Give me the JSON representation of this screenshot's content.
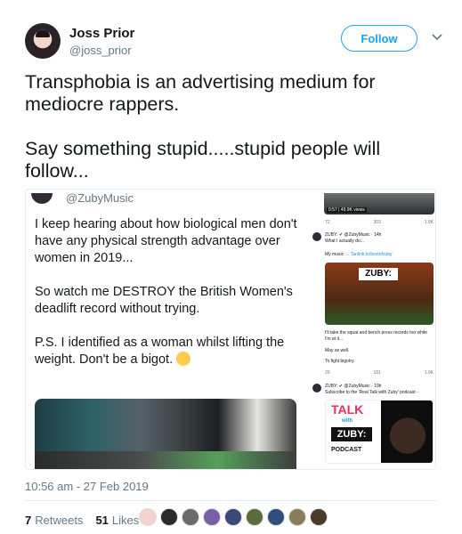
{
  "author": {
    "name": "Joss Prior",
    "handle": "@joss_prior",
    "follow_label": "Follow"
  },
  "tweet": {
    "paragraphs": [
      "Transphobia is an advertising medium for mediocre rappers.",
      "Say something stupid.....stupid people will follow..."
    ],
    "timestamp": "10:56 am - 27 Feb 2019"
  },
  "quoted": {
    "handle": "@ZubyMusic",
    "paragraphs": [
      "I keep hearing about how biological men don't have any physical strength advantage over women in 2019...",
      "So watch me DESTROY the British Women's deadlift record without trying.",
      "P.S. I identified as a woman whilst lifting the weight. Don't be a bigot."
    ]
  },
  "right_column": {
    "video_label": "0:57 | 49.9K views",
    "stats_top": [
      "72",
      "303",
      "1.9K"
    ],
    "row1_name": "ZUBY: ✔ @ZubyMusic · 14h",
    "row1_text": "What I actually do...",
    "row1_link_pre": "My music →",
    "row1_link": "Tanlink.to/bestofzuby",
    "banner_label": "ZUBY:",
    "mid_text_1": "I'll take the squat and bench press records too while I'm at it...",
    "mid_text_2": "May as well.",
    "mid_text_3": "To fight bigotry.",
    "stats_mid": [
      "29",
      "181",
      "1.9K"
    ],
    "row2_name": "ZUBY: ✔ @ZubyMusic · 19h",
    "row2_text": "Subscribe to the 'Real Talk with Zuby' podcast -",
    "card_talk": "TALK",
    "card_with": "with",
    "card_zuby": "ZUBY:",
    "card_podcast": "PODCAST"
  },
  "engagement": {
    "retweets_count": "7",
    "retweets_label": "Retweets",
    "likes_count": "51",
    "likes_label": "Likes"
  },
  "colors": {
    "accent": "#1da1f2",
    "text": "#14171a",
    "muted": "#657786"
  }
}
